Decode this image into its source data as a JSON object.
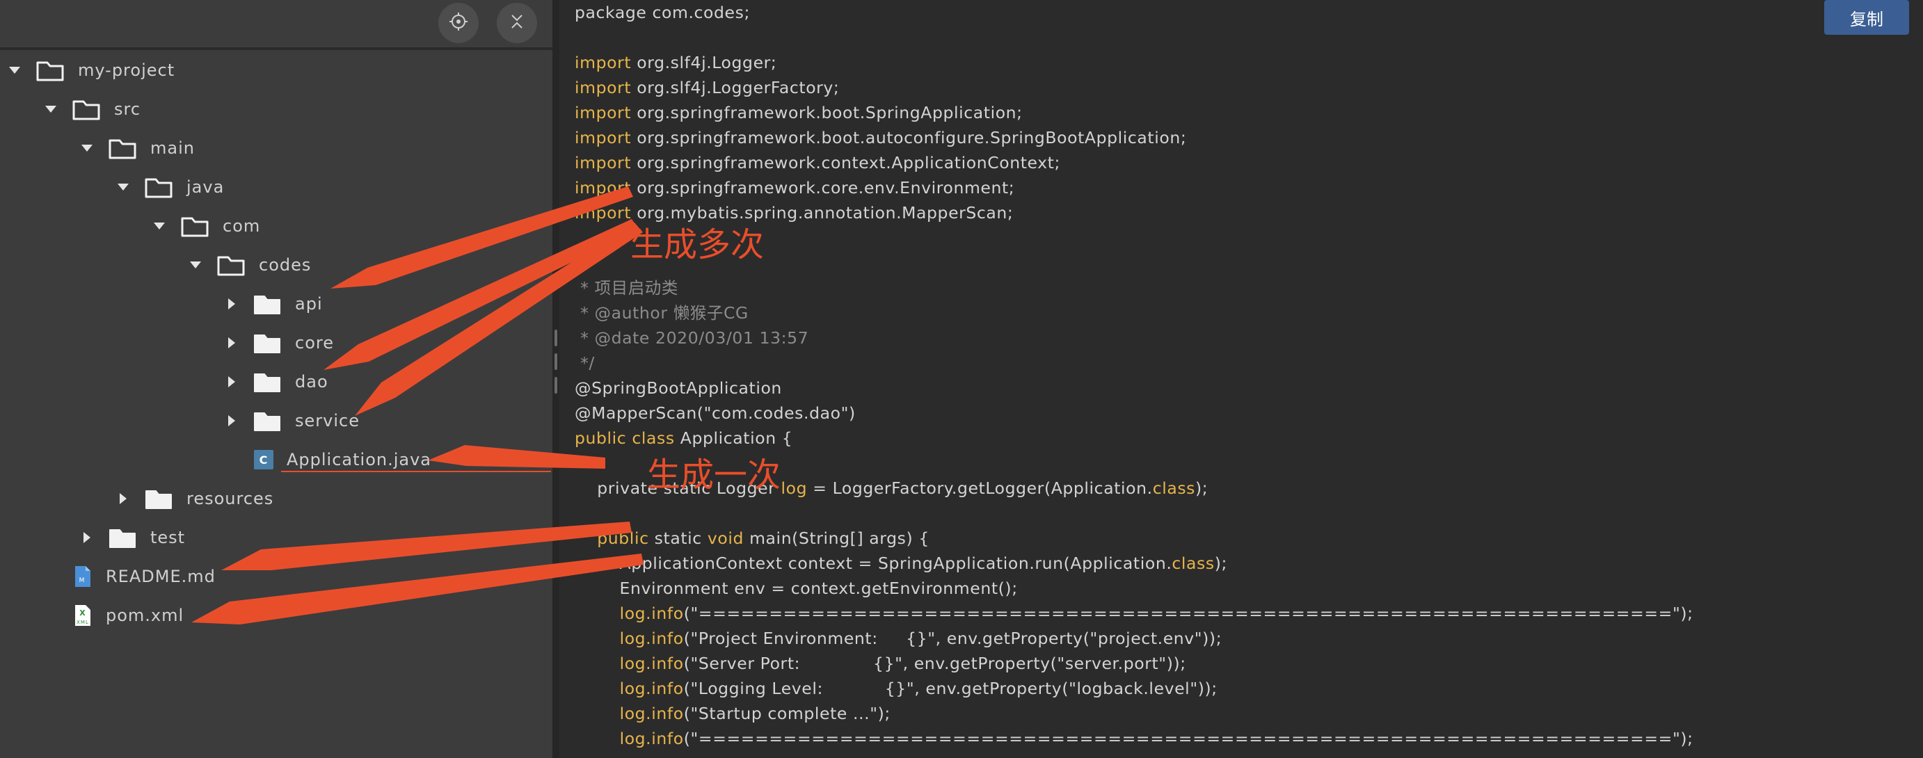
{
  "toolbar": {
    "locate_icon": "locate-icon",
    "collapse_icon": "collapse-all-icon"
  },
  "tree": {
    "items": [
      {
        "label": "my-project",
        "type": "folder",
        "expanded": true,
        "depth": 0
      },
      {
        "label": "src",
        "type": "folder",
        "expanded": true,
        "depth": 1
      },
      {
        "label": "main",
        "type": "folder",
        "expanded": true,
        "depth": 2
      },
      {
        "label": "java",
        "type": "folder",
        "expanded": true,
        "depth": 3
      },
      {
        "label": "com",
        "type": "folder",
        "expanded": true,
        "depth": 4
      },
      {
        "label": "codes",
        "type": "folder",
        "expanded": true,
        "depth": 5
      },
      {
        "label": "api",
        "type": "folder",
        "expanded": false,
        "depth": 6
      },
      {
        "label": "core",
        "type": "folder",
        "expanded": false,
        "depth": 6
      },
      {
        "label": "dao",
        "type": "folder",
        "expanded": false,
        "depth": 6
      },
      {
        "label": "service",
        "type": "folder",
        "expanded": false,
        "depth": 6
      },
      {
        "label": "Application.java",
        "type": "java-class",
        "depth": 6
      },
      {
        "label": "resources",
        "type": "folder",
        "expanded": false,
        "depth": 3
      },
      {
        "label": "test",
        "type": "folder",
        "expanded": false,
        "depth": 2
      },
      {
        "label": "README.md",
        "type": "markdown",
        "depth": 1
      },
      {
        "label": "pom.xml",
        "type": "xml",
        "depth": 1
      }
    ]
  },
  "copy_button": {
    "label": "复制"
  },
  "code": {
    "lines": [
      "package com.codes;",
      "",
      "import org.slf4j.Logger;",
      "import org.slf4j.LoggerFactory;",
      "import org.springframework.boot.SpringApplication;",
      "import org.springframework.boot.autoconfigure.SpringBootApplication;",
      "import org.springframework.context.ApplicationContext;",
      "import org.springframework.core.env.Environment;",
      "import org.mybatis.spring.annotation.MapperScan;",
      "",
      " *",
      " * 项目启动类",
      " * @author 懒猴子CG",
      " * @date 2020/03/01 13:57",
      " */",
      "@SpringBootApplication",
      "@MapperScan(\"com.codes.dao\")",
      "public class Application {",
      "",
      "    private static Logger log = LoggerFactory.getLogger(Application.class);",
      "",
      "    public static void main(String[] args) {",
      "        ApplicationContext context = SpringApplication.run(Application.class);",
      "        Environment env = context.getEnvironment();",
      "        log.info(\"=====================================================================\");",
      "        log.info(\"Project Environment:     {}\", env.getProperty(\"project.env\"));",
      "        log.info(\"Server Port:             {}\", env.getProperty(\"server.port\"));",
      "        log.info(\"Logging Level:           {}\", env.getProperty(\"logback.level\"));",
      "        log.info(\"Startup complete ...\");",
      "        log.info(\"=====================================================================\");"
    ]
  },
  "annotations": {
    "multiple": "生成多次",
    "once": "生成一次",
    "color": "#e94e2b"
  },
  "colors": {
    "tree_bg": "#3c3c3c",
    "code_bg": "#2b2b2b",
    "keyword": "#e8b54b",
    "copy_button": "#3b5f94"
  }
}
